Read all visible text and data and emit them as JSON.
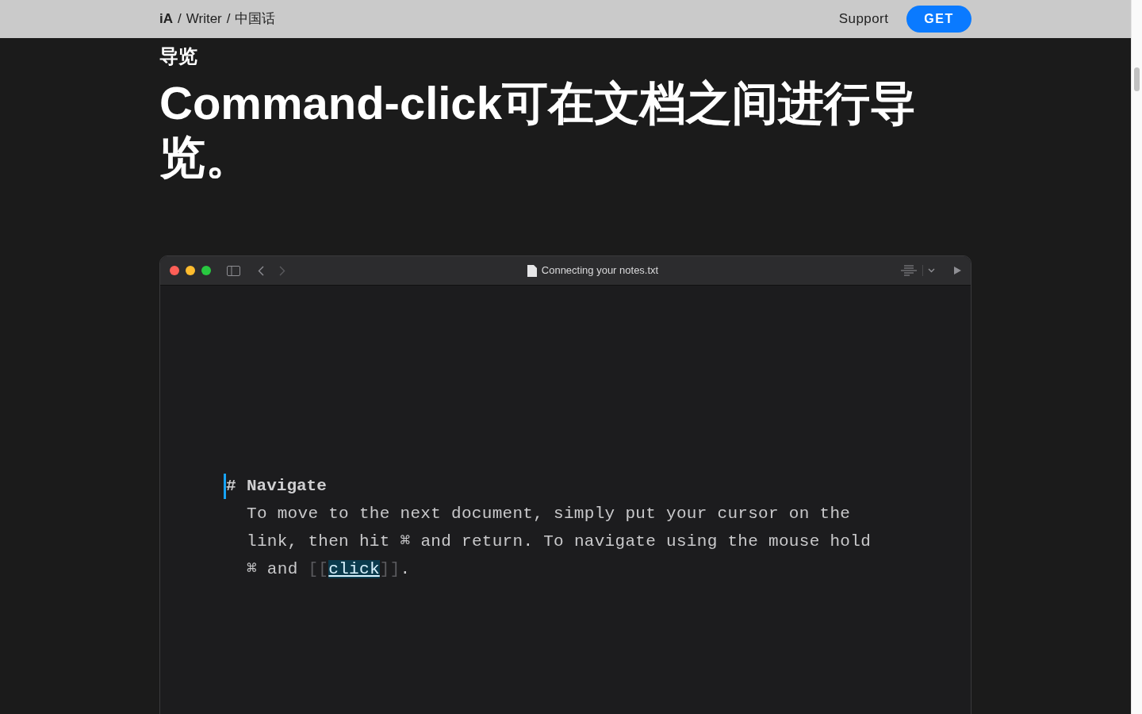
{
  "nav": {
    "breadcrumb": [
      "iA",
      "Writer",
      "中国话"
    ],
    "separator": "/",
    "links": [
      "Support"
    ],
    "cta": "GET"
  },
  "section": {
    "eyebrow": "导览",
    "headline": "Command-click可在文档之间进行导览。"
  },
  "editor_window": {
    "title": "Connecting your notes.txt",
    "document": {
      "heading_marker": "#",
      "heading": "Navigate",
      "text_before": "To move to the next document, simply put your cursor on the link, then hit ⌘ and return. To navigate using the mouse hold ⌘ and ",
      "link_open": "[[",
      "link": "click",
      "link_close": "]]",
      "text_after": "."
    }
  }
}
